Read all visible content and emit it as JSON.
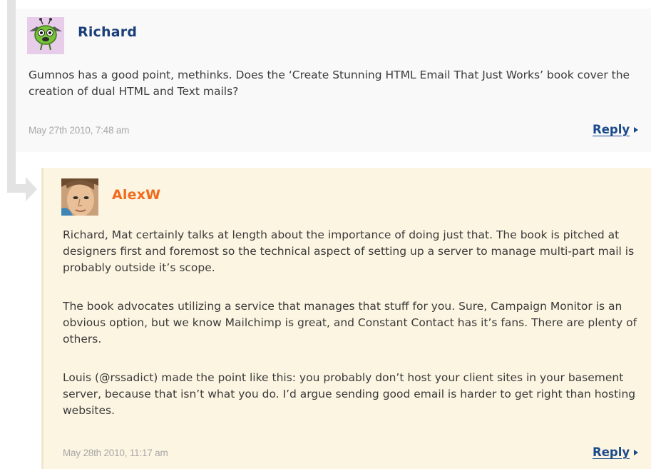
{
  "comments": [
    {
      "author": "Richard",
      "author_color": "#1b3f7a",
      "avatar": "bug-monster-avatar",
      "paragraphs": [
        "Gumnos has a good point, methinks. Does the ‘Create Stunning HTML Email That Just Works’ book cover the creation of dual HTML and Text mails?"
      ],
      "date": "May 27th 2010, 7:48 am",
      "reply_label": "Reply"
    },
    {
      "author": "AlexW",
      "author_color": "#f26a1b",
      "avatar": "face-portrait-avatar",
      "paragraphs": [
        "Richard, Mat certainly talks at length about the importance of doing just that. The book is pitched at designers first and foremost so the technical aspect of setting up a server to manage multi-part mail is probably outside it’s scope.",
        "The book advocates utilizing a service that manages that stuff for you. Sure, Campaign Monitor is an obvious option, but we know Mailchimp is great, and Constant Contact has it’s fans. There are plenty of others.",
        "Louis (@rssadict) made the point like this: you probably don’t host your client sites in your basement server, because that isn’t what you do. I’d argue sending good email is harder to get right than hosting websites."
      ],
      "date": "May 28th 2010, 11:17 am",
      "reply_label": "Reply"
    }
  ]
}
